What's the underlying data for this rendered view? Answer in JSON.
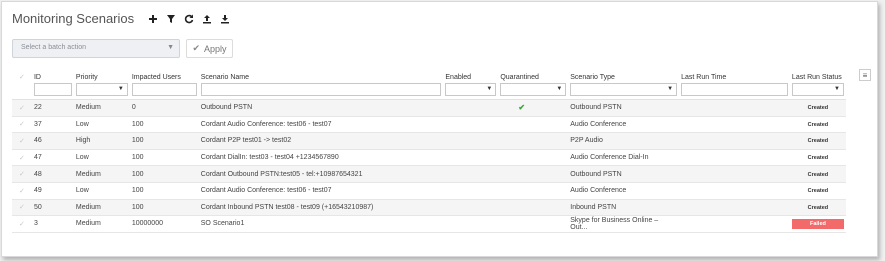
{
  "title": "Monitoring Scenarios",
  "toolbar": {
    "icons": [
      "add-icon",
      "filter-icon",
      "refresh-icon",
      "upload-icon",
      "download-icon"
    ]
  },
  "batch": {
    "placeholder": "Select a batch action",
    "apply_label": "Apply"
  },
  "columns": [
    "ID",
    "Priority",
    "Impacted Users",
    "Scenario Name",
    "Enabled",
    "Quarantined",
    "Scenario Type",
    "Last Run Time",
    "Last Run Status"
  ],
  "rows": [
    {
      "id": "22",
      "priority": "Medium",
      "users": "0",
      "name": "Outbound PSTN",
      "enabled": "",
      "quarantined": true,
      "type": "Outbound PSTN",
      "last_run": "",
      "status": "Created"
    },
    {
      "id": "37",
      "priority": "Low",
      "users": "100",
      "name": "Cordant Audio Conference: test06 - test07",
      "enabled": "",
      "quarantined": false,
      "type": "Audio Conference",
      "last_run": "",
      "status": "Created"
    },
    {
      "id": "46",
      "priority": "High",
      "users": "100",
      "name": "Cordant P2P test01 -> test02",
      "enabled": "",
      "quarantined": false,
      "type": "P2P Audio",
      "last_run": "",
      "status": "Created"
    },
    {
      "id": "47",
      "priority": "Low",
      "users": "100",
      "name": "Cordant DialIn: test03 - test04 +1234567890",
      "enabled": "",
      "quarantined": false,
      "type": "Audio Conference Dial-In",
      "last_run": "",
      "status": "Created"
    },
    {
      "id": "48",
      "priority": "Medium",
      "users": "100",
      "name": "Cordant Outbound PSTN:test05 - tel:+10987654321",
      "enabled": "",
      "quarantined": false,
      "type": "Outbound PSTN",
      "last_run": "",
      "status": "Created"
    },
    {
      "id": "49",
      "priority": "Low",
      "users": "100",
      "name": "Cordant Audio Conference: test06 - test07",
      "enabled": "",
      "quarantined": false,
      "type": "Audio Conference",
      "last_run": "",
      "status": "Created"
    },
    {
      "id": "50",
      "priority": "Medium",
      "users": "100",
      "name": "Cordant Inbound PSTN test08 - test09 (+16543210987)",
      "enabled": "",
      "quarantined": false,
      "type": "Inbound PSTN",
      "last_run": "",
      "status": "Created"
    },
    {
      "id": "3",
      "priority": "Medium",
      "users": "10000000",
      "name": "SO Scenario1",
      "enabled": "",
      "quarantined": false,
      "type": "Skype for Business Online – Out...",
      "last_run": "",
      "status": "Failed"
    }
  ],
  "colors": {
    "failed": "#f26a6a",
    "quarantine_check": "#3aa63a"
  }
}
